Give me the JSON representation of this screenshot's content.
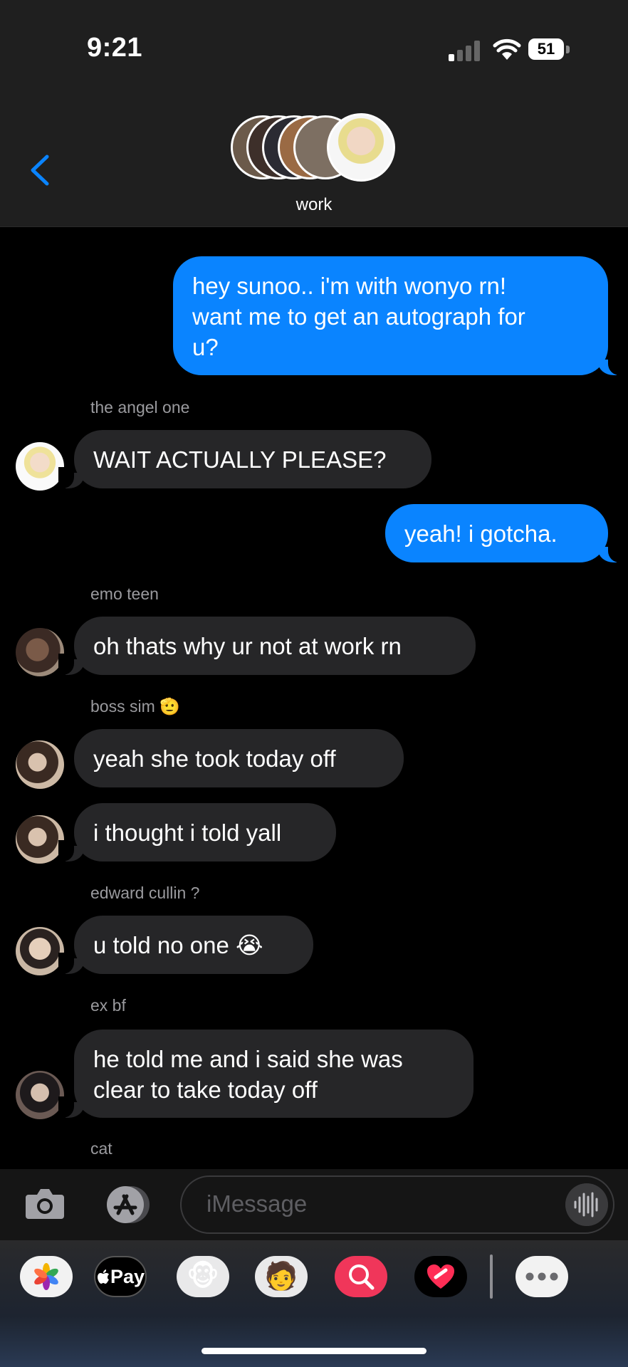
{
  "status_bar": {
    "time": "9:21",
    "battery": "51",
    "battery_level": 0.51
  },
  "header": {
    "group_name": "work"
  },
  "messages": [
    {
      "dir": "out",
      "lines": [
        "hey sunoo.. i'm with wonyo rn!",
        "want me to get an autograph for",
        "u?"
      ]
    },
    {
      "dir": "in",
      "sender": "the angel one",
      "lines": [
        "WAIT ACTUALLY PLEASE?"
      ]
    },
    {
      "dir": "out",
      "lines": [
        "yeah! i gotcha."
      ]
    },
    {
      "dir": "in",
      "sender": "emo teen",
      "lines": [
        "oh thats why ur not at work rn"
      ]
    },
    {
      "dir": "in",
      "sender": "boss sim",
      "sender_emoji": "🫡",
      "lines": [
        "yeah she took today off"
      ]
    },
    {
      "dir": "in",
      "lines": [
        "i thought i told yall"
      ]
    },
    {
      "dir": "in",
      "sender": "edward cullin ?",
      "lines": [
        "u told no one",
        "😭"
      ]
    },
    {
      "dir": "in",
      "sender": "ex bf",
      "lines": [
        "he told me and i said she was",
        "clear to take today off"
      ]
    },
    {
      "dir": "in",
      "sender": "cat"
    }
  ],
  "compose": {
    "placeholder": "iMessage"
  },
  "app_drawer": {
    "apple_pay_label": "Pay",
    "apple_pay_icon": "apple-icon"
  },
  "colors": {
    "outgoing": "#0a84ff",
    "incoming": "#262628",
    "accent": "#0a84ff"
  }
}
